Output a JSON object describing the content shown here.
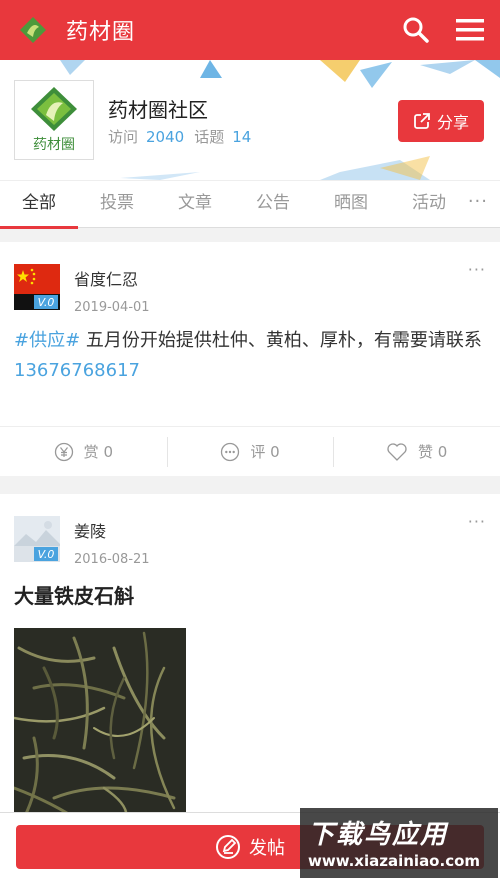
{
  "app": {
    "title": "药材圈"
  },
  "colors": {
    "brand_red": "#e8383d",
    "link_blue": "#4aa3df",
    "muted": "#999999"
  },
  "group": {
    "name": "药材圈社区",
    "visits_label": "访问",
    "visits": "2040",
    "topics_label": "话题",
    "topics": "14",
    "share_label": "分享"
  },
  "tabs": [
    {
      "label": "全部",
      "active": true
    },
    {
      "label": "投票"
    },
    {
      "label": "文章"
    },
    {
      "label": "公告"
    },
    {
      "label": "晒图"
    },
    {
      "label": "活动"
    }
  ],
  "tabs_more": "···",
  "posts": [
    {
      "author": "省度仁忍",
      "date": "2019-04-01",
      "badge": "V.0",
      "tag": "#供应#",
      "text": " 五月份开始提供杜仲、黄柏、厚朴，有需要请联系",
      "phone": "13676768617",
      "reward": "赏 0",
      "comment": "评 0",
      "like": "赞 0"
    },
    {
      "author": "姜陵",
      "date": "2016-08-21",
      "badge": "V.0",
      "title": "大量铁皮石斛"
    }
  ],
  "bottom": {
    "post_label": "发帖"
  },
  "watermark": {
    "top": "下载鸟应用",
    "bottom": "www.xiazainiao.com"
  }
}
